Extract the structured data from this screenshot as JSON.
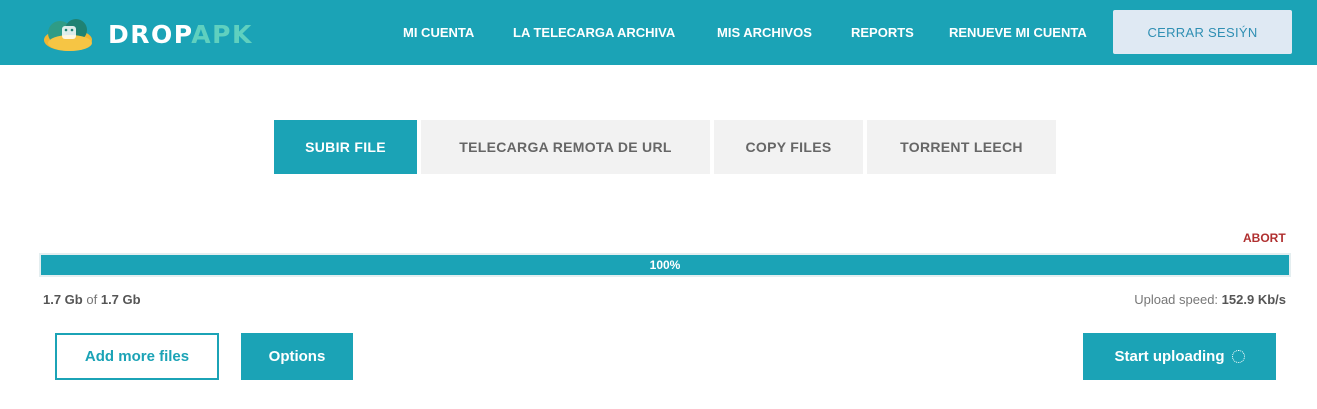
{
  "brand": {
    "part1": "DROP",
    "part2": "APK"
  },
  "nav": {
    "items": [
      "MI CUENTA",
      "LA TELECARGA ARCHIVA",
      "MIS ARCHIVOS",
      "REPORTS",
      "RENUEVE MI CUENTA"
    ],
    "logout_label": "CERRAR SESIÝN"
  },
  "tabs": [
    {
      "label": "SUBIR FILE",
      "active": true
    },
    {
      "label": "TELECARGA REMOTA DE URL",
      "active": false
    },
    {
      "label": "COPY FILES",
      "active": false
    },
    {
      "label": "TORRENT LEECH",
      "active": false
    }
  ],
  "upload": {
    "abort_label": "ABORT",
    "progress_percent": 100,
    "progress_label": "100%",
    "uploaded": "1.7 Gb",
    "of_text": "of",
    "total": "1.7 Gb",
    "speed_label": "Upload speed:",
    "speed_value": "152.9 Kb/s"
  },
  "actions": {
    "add_more": "Add more files",
    "options": "Options",
    "start": "Start uploading"
  },
  "colors": {
    "accent": "#1ba3b6",
    "logout_bg": "#dfe9f3",
    "abort": "#b03030"
  }
}
